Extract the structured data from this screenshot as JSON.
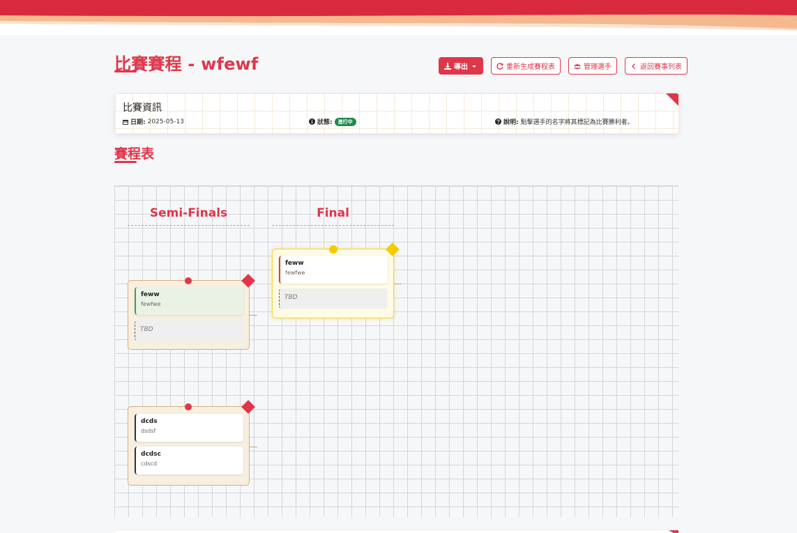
{
  "header": {
    "title": "比賽賽程 - wfewf",
    "brand_color": "#e0364a"
  },
  "toolbar": {
    "export_label": "導出",
    "regenerate_label": "重新生成賽程表",
    "manage_label": "管理選手",
    "back_label": "返回賽事列表"
  },
  "info": {
    "title": "比賽資訊",
    "date_label": "日期:",
    "date_value": "2025-05-13",
    "status_label": "狀態:",
    "status_value": "進行中",
    "note_label": "說明:",
    "note_value": "點擊選手的名字將其標記為比賽勝利者。"
  },
  "section": {
    "title": "賽程表"
  },
  "bracket": {
    "rounds": [
      {
        "title": "Semi-Finals"
      },
      {
        "title": "Final"
      }
    ],
    "matches": {
      "semi1": {
        "player1": {
          "name": "feww",
          "sub": "fewfwe",
          "winner": true
        },
        "player2": {
          "placeholder": "TBD"
        }
      },
      "semi2": {
        "player1": {
          "name": "dcds",
          "sub": "dsdsf"
        },
        "player2": {
          "name": "dcdsc",
          "sub": "cdscd"
        }
      },
      "final": {
        "player1": {
          "name": "feww",
          "sub": "fewfwe"
        },
        "player2": {
          "placeholder": "TBD"
        }
      }
    }
  }
}
